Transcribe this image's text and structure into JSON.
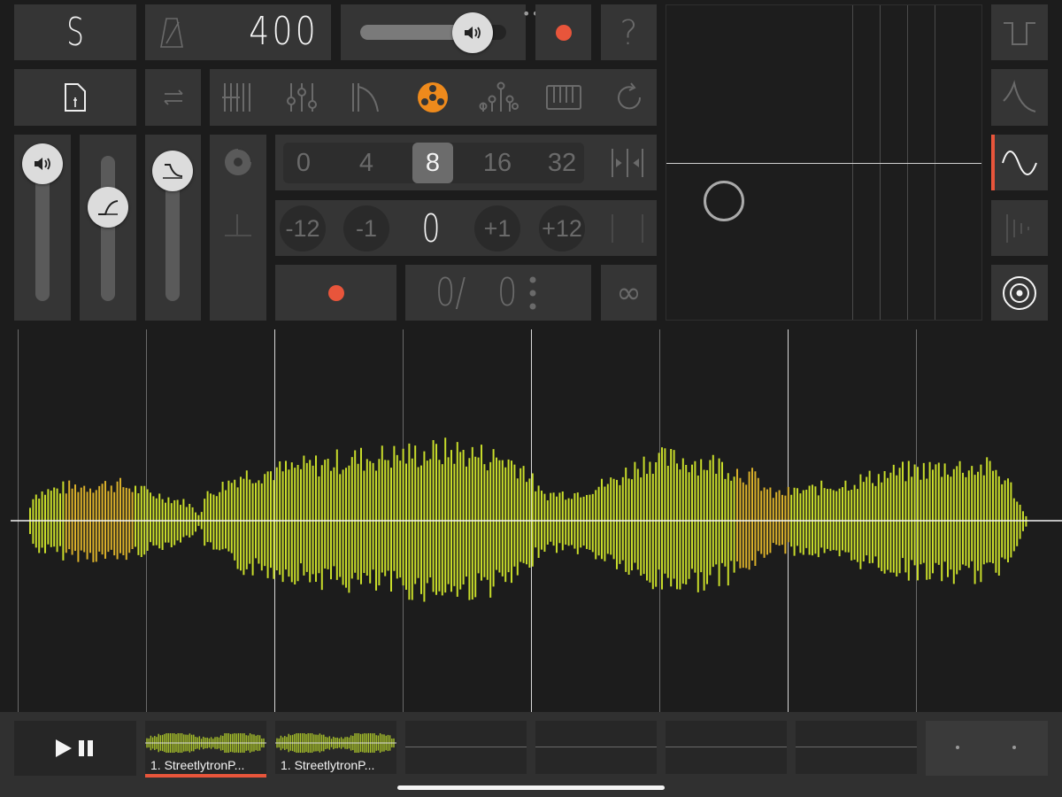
{
  "header": {
    "logo": "S",
    "tempo": "400",
    "help_label": "?",
    "volume_level": 0.78
  },
  "toolbar": {
    "icons": [
      "file-icon",
      "transfer-icon",
      "sequencer-icon",
      "mixer-icon",
      "shaper-icon",
      "tape-reel-icon",
      "nodes-icon",
      "keyboard-icon",
      "loop-icon"
    ],
    "active": "tape-reel-icon"
  },
  "grid": {
    "options": [
      "0",
      "4",
      "8",
      "16",
      "32"
    ],
    "selected": "8"
  },
  "pitch": {
    "options": [
      "-12",
      "-1",
      "0",
      "+1",
      "+12"
    ],
    "value": "0"
  },
  "recorder": {
    "count": "0/",
    "total": "0",
    "loop_symbol": "∞"
  },
  "waveforms": [
    "square-wave-icon",
    "decay-wave-icon",
    "sine-wave-icon",
    "pulse-wave-icon",
    "target-icon"
  ],
  "active_waveform": "sine-wave-icon",
  "clips": [
    {
      "label": "1. StreetlytronP..."
    },
    {
      "label": "1. StreetlytronP..."
    },
    {
      "label": ""
    },
    {
      "label": ""
    },
    {
      "label": ""
    }
  ],
  "colors": {
    "accent": "#e8553b",
    "waveform": "#c8dc2a",
    "active_icon": "#ee8a1c",
    "panel": "#353535",
    "background": "#1c1c1c"
  }
}
